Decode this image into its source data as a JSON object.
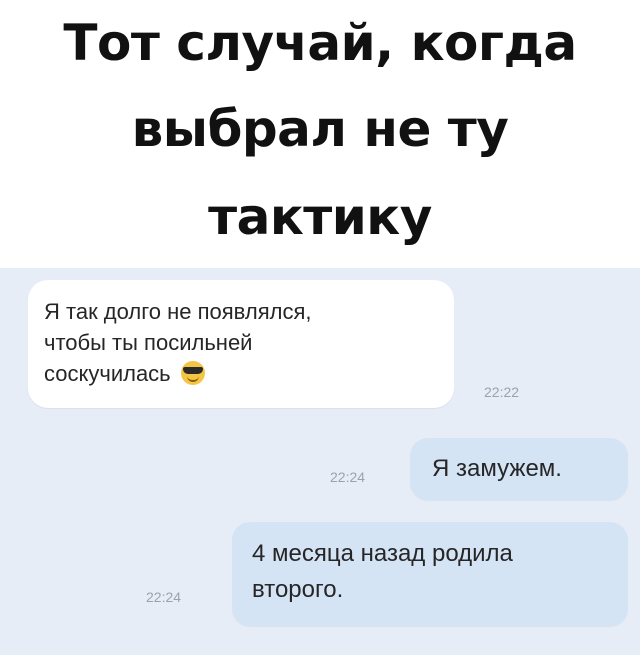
{
  "caption": {
    "lines": [
      "Тот случай, когда",
      "выбрал не ту",
      "тактику"
    ]
  },
  "messages": [
    {
      "direction": "incoming",
      "lines": [
        "Я так долго не появлялся,",
        "чтобы ты посильней",
        "соскучилась"
      ],
      "emoji": "sunglasses-emoji-icon",
      "time": "22:22"
    },
    {
      "direction": "outgoing",
      "lines": [
        "Я замужем."
      ],
      "time": "22:24"
    },
    {
      "direction": "outgoing",
      "lines": [
        "4 месяца назад родила",
        "второго."
      ],
      "time": "22:24"
    }
  ],
  "colors": {
    "chat_background": "#e6edf6",
    "incoming_bubble": "#ffffff",
    "outgoing_bubble": "#d5e4f5",
    "timestamp": "#9aa3ad",
    "caption_text": "#111111"
  }
}
